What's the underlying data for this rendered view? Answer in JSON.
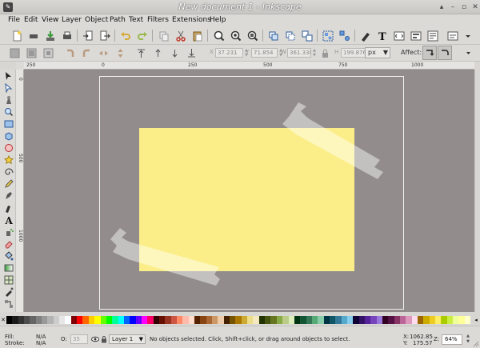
{
  "window": {
    "title": "New document 1 - Inkscape",
    "controls": [
      "▴",
      "–",
      "▫",
      "✕"
    ]
  },
  "menubar": {
    "items": [
      "File",
      "Edit",
      "View",
      "Layer",
      "Object",
      "Path",
      "Text",
      "Filters",
      "Extensions",
      "Help"
    ]
  },
  "commands": {
    "icons": [
      "new-icon",
      "open-icon",
      "save-icon",
      "print-icon",
      "import-icon",
      "export-icon",
      "undo-icon",
      "redo-icon",
      "copy-icon",
      "cut-icon",
      "paste-icon",
      "zoom-selection-icon",
      "zoom-drawing-icon",
      "zoom-page-icon",
      "duplicate-icon",
      "clone-icon",
      "unlink-clone-icon",
      "group-icon",
      "ungroup-icon",
      "fill-stroke-icon",
      "text-font-icon",
      "xml-editor-icon",
      "align-icon",
      "preferences-icon"
    ]
  },
  "controls": {
    "x_label": "X",
    "x_value": "37.231",
    "y_label": "Y",
    "y_value": "71.854",
    "w_label": "W",
    "w_value": "361.338",
    "h_label": "H",
    "h_value": "199.876",
    "unit": "px",
    "affect_label": "Affect:"
  },
  "toolbox": {
    "tools": [
      "selector-tool-icon",
      "node-tool-icon",
      "tweak-tool-icon",
      "zoom-tool-icon",
      "rect-tool-icon",
      "3dbox-tool-icon",
      "ellipse-tool-icon",
      "star-tool-icon",
      "spiral-tool-icon",
      "pencil-tool-icon",
      "pen-tool-icon",
      "calligraphy-tool-icon",
      "text-tool-icon",
      "spray-tool-icon",
      "eraser-tool-icon",
      "bucket-tool-icon",
      "gradient-tool-icon",
      "mesh-tool-icon",
      "dropper-tool-icon",
      "connector-tool-icon"
    ]
  },
  "rulers": {
    "top": [
      "250",
      "0",
      "250",
      "500",
      "750",
      "1000"
    ],
    "left": [
      "0",
      "500",
      "1000"
    ]
  },
  "colors": {
    "canvas": "#928c8c",
    "rectangle_fill": "#fbee88",
    "page_border": "#f3f3f3"
  },
  "palette": [
    "#000000",
    "#1a1a1a",
    "#333333",
    "#4d4d4d",
    "#666666",
    "#808080",
    "#999999",
    "#b3b3b3",
    "#cccccc",
    "#e6e6e6",
    "#ffffff",
    "#800000",
    "#ff0000",
    "#ff6600",
    "#ffcc00",
    "#ffff00",
    "#66ff00",
    "#00ff00",
    "#00ff99",
    "#00ffff",
    "#0066ff",
    "#0000ff",
    "#6600ff",
    "#ff00ff",
    "#ff0066",
    "#330000",
    "#661100",
    "#993322",
    "#cc5544",
    "#ff8866",
    "#ffbbaa",
    "#ffddcc",
    "#552200",
    "#884411",
    "#aa6633",
    "#cc9966",
    "#eeccaa",
    "#442200",
    "#775500",
    "#aa7700",
    "#ccaa33",
    "#eedd88",
    "#f4e8c0",
    "#223300",
    "#445511",
    "#667722",
    "#88aa44",
    "#bbcc88",
    "#ddeebb",
    "#003311",
    "#115533",
    "#337755",
    "#55aa77",
    "#88ccaa",
    "#003344",
    "#115566",
    "#337799",
    "#55aacc",
    "#88ccee",
    "#110033",
    "#331166",
    "#552299",
    "#7744bb",
    "#9977dd",
    "#330022",
    "#551144",
    "#883366",
    "#bb6699",
    "#dd99bb",
    "#ffddee",
    "#996600",
    "#ccaa00",
    "#eecc22",
    "#ffee66",
    "#aacc00",
    "#ccee44",
    "#eeff99",
    "#ffff99",
    "#ffffcc"
  ],
  "status": {
    "fill_label": "Fill:",
    "fill_value": "N/A",
    "stroke_label": "Stroke:",
    "stroke_value": "N/A",
    "opacity_label": "O:",
    "opacity_value": "35",
    "layer": "Layer 1",
    "message": "No objects selected. Click, Shift+click, or drag around objects to select.",
    "x_label": "X:",
    "x_coord": "1062.85",
    "y_label": "Y:",
    "y_coord": "175.57",
    "zoom_label": "Z:",
    "zoom_value": "64%"
  }
}
